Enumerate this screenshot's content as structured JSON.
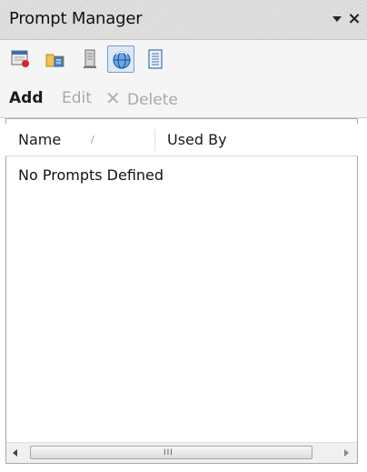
{
  "window": {
    "title": "Prompt Manager",
    "pin_icon": "dropdown-arrow-icon",
    "close_icon": "close-icon",
    "close_glyph": "×"
  },
  "toolbar_icons": [
    {
      "name": "calendar-icon",
      "active": false
    },
    {
      "name": "folder-icon",
      "active": false
    },
    {
      "name": "server-icon",
      "active": false
    },
    {
      "name": "globe-refresh-icon",
      "active": true
    },
    {
      "name": "document-list-icon",
      "active": false
    }
  ],
  "actions": {
    "add_label": "Add",
    "edit_label": "Edit",
    "delete_label": "Delete",
    "delete_glyph": "✕"
  },
  "table": {
    "columns": [
      "Name",
      "Used By"
    ],
    "sort_glyph": "/",
    "empty_text": "No Prompts Defined"
  },
  "scrollbar": {
    "grip_glyph": "III"
  },
  "colors": {
    "active_icon_border": "#7a9ec9",
    "disabled_text": "#a8a8a8"
  }
}
